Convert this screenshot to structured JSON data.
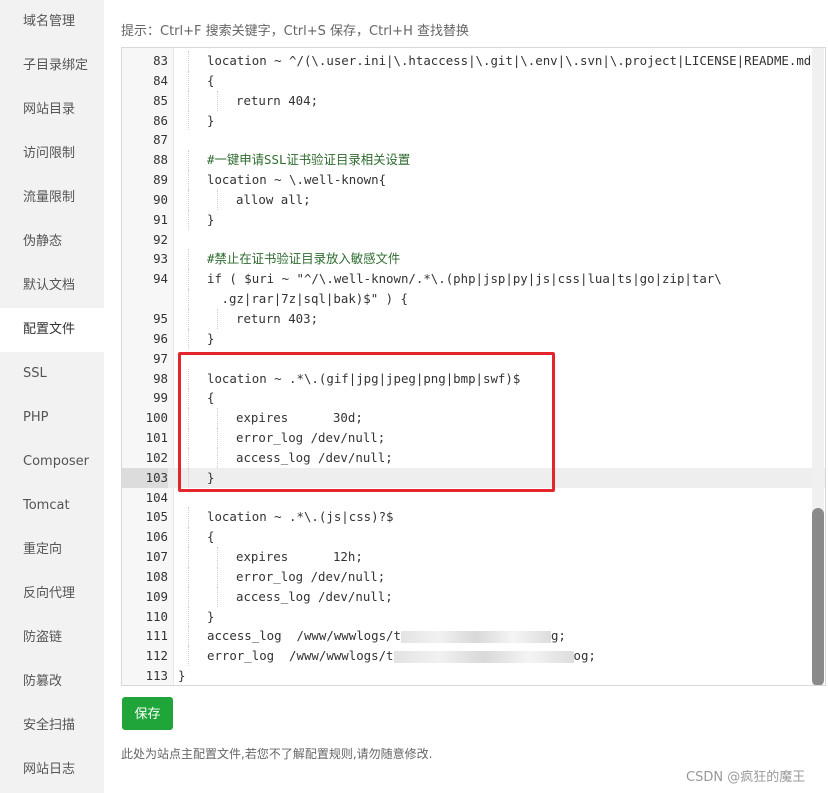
{
  "sidebar": {
    "items": [
      {
        "label": "域名管理"
      },
      {
        "label": "子目录绑定"
      },
      {
        "label": "网站目录"
      },
      {
        "label": "访问限制"
      },
      {
        "label": "流量限制"
      },
      {
        "label": "伪静态"
      },
      {
        "label": "默认文档"
      },
      {
        "label": "配置文件"
      },
      {
        "label": "SSL"
      },
      {
        "label": "PHP"
      },
      {
        "label": "Composer"
      },
      {
        "label": "Tomcat"
      },
      {
        "label": "重定向"
      },
      {
        "label": "反向代理"
      },
      {
        "label": "防盗链"
      },
      {
        "label": "防篡改"
      },
      {
        "label": "安全扫描"
      },
      {
        "label": "网站日志"
      }
    ],
    "active_index": 7
  },
  "hint": "提示：Ctrl+F 搜索关键字，Ctrl+S 保存，Ctrl+H 查找替换",
  "editor": {
    "lines": [
      {
        "n": "83",
        "text": "location ~ ^/(\\.user.ini|\\.htaccess|\\.git|\\.env|\\.svn|\\.project|LICENSE|README.md)"
      },
      {
        "n": "84",
        "text": "{"
      },
      {
        "n": "85",
        "text": "return 404;"
      },
      {
        "n": "86",
        "text": "}"
      },
      {
        "n": "87",
        "text": ""
      },
      {
        "n": "88",
        "text": "#一键申请SSL证书验证目录相关设置"
      },
      {
        "n": "89",
        "text": "location ~ \\.well-known{"
      },
      {
        "n": "90",
        "text": "allow all;"
      },
      {
        "n": "91",
        "text": "}"
      },
      {
        "n": "92",
        "text": ""
      },
      {
        "n": "93",
        "text": "#禁止在证书验证目录放入敏感文件"
      },
      {
        "n": "94",
        "text": "if ( $uri ~ \"^/\\.well-known/.*\\.(php|jsp|py|js|css|lua|ts|go|zip|tar\\"
      },
      {
        "n": "",
        "text": ".gz|rar|7z|sql|bak)$\" ) {"
      },
      {
        "n": "95",
        "text": "return 403;"
      },
      {
        "n": "96",
        "text": "}"
      },
      {
        "n": "97",
        "text": ""
      },
      {
        "n": "98",
        "text": "location ~ .*\\.(gif|jpg|jpeg|png|bmp|swf)$"
      },
      {
        "n": "99",
        "text": "{"
      },
      {
        "n": "100",
        "text": "expires      30d;"
      },
      {
        "n": "101",
        "text": "error_log /dev/null;"
      },
      {
        "n": "102",
        "text": "access_log /dev/null;"
      },
      {
        "n": "103",
        "text": "}"
      },
      {
        "n": "104",
        "text": ""
      },
      {
        "n": "105",
        "text": "location ~ .*\\.(js|css)?$"
      },
      {
        "n": "106",
        "text": "{"
      },
      {
        "n": "107",
        "text": "expires      12h;"
      },
      {
        "n": "108",
        "text": "error_log /dev/null;"
      },
      {
        "n": "109",
        "text": "access_log /dev/null;"
      },
      {
        "n": "110",
        "text": "}"
      },
      {
        "n": "111",
        "text": "access_log  /www/wwwlogs/t"
      },
      {
        "n": "112",
        "text": "error_log  /www/wwwlogs/t"
      },
      {
        "n": "113",
        "text": "}"
      }
    ],
    "line111_tail": "g;",
    "line112_tail": "og;"
  },
  "save_label": "保存",
  "note": "此处为站点主配置文件,若您不了解配置规则,请勿随意修改.",
  "watermark": "CSDN @疯狂的魔王",
  "colors": {
    "accent": "#20a53a",
    "highlight": "#e3262c"
  }
}
